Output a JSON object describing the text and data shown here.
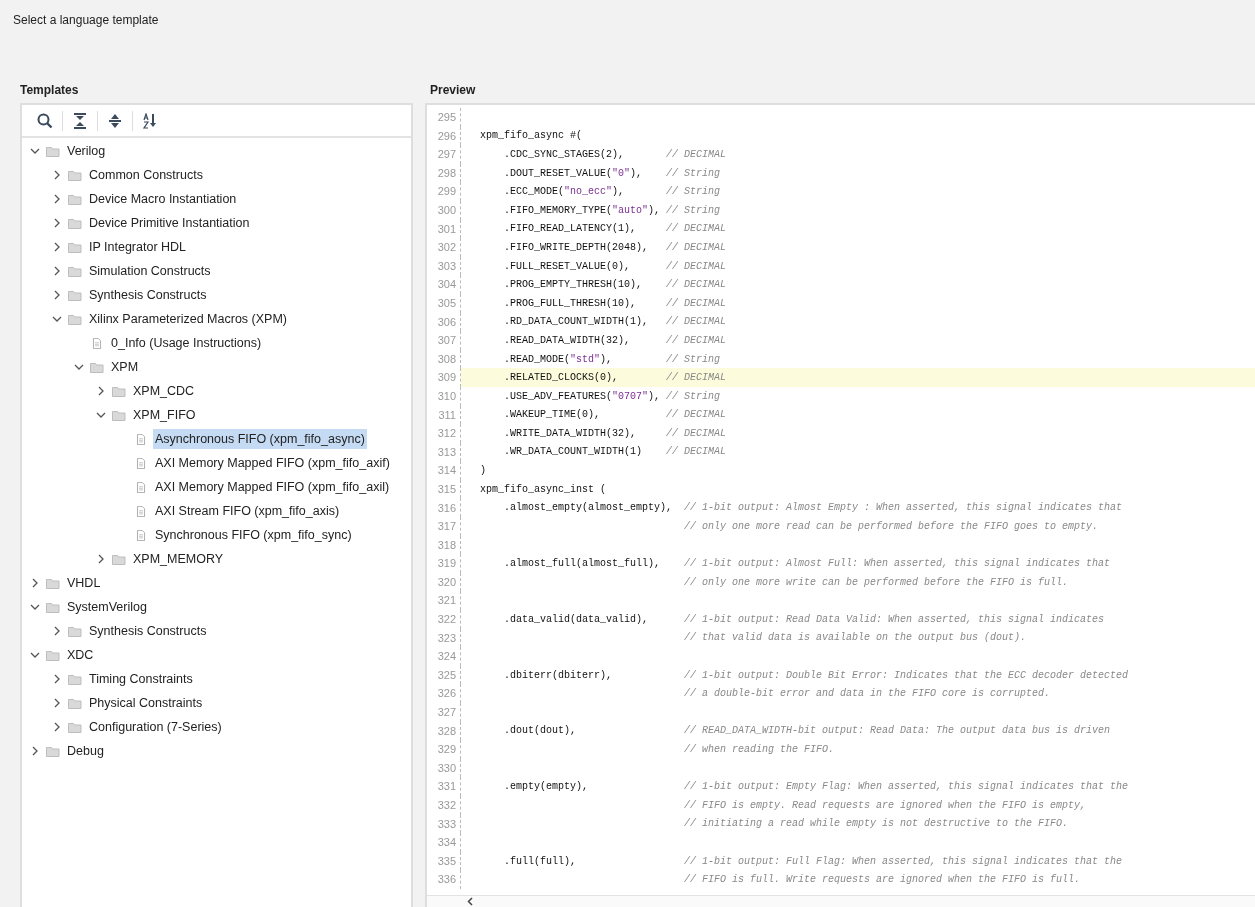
{
  "heading": "Select a language template",
  "templates": {
    "title": "Templates",
    "tree": [
      {
        "label": "Verilog",
        "kind": "folder",
        "expanded": true,
        "selected": false,
        "children": [
          {
            "label": "Common Constructs",
            "kind": "folder",
            "expanded": false,
            "selected": false
          },
          {
            "label": "Device Macro Instantiation",
            "kind": "folder",
            "expanded": false,
            "selected": false
          },
          {
            "label": "Device Primitive Instantiation",
            "kind": "folder",
            "expanded": false,
            "selected": false
          },
          {
            "label": "IP Integrator HDL",
            "kind": "folder",
            "expanded": false,
            "selected": false
          },
          {
            "label": "Simulation Constructs",
            "kind": "folder",
            "expanded": false,
            "selected": false
          },
          {
            "label": "Synthesis Constructs",
            "kind": "folder",
            "expanded": false,
            "selected": false
          },
          {
            "label": "Xilinx Parameterized Macros (XPM)",
            "kind": "folder",
            "expanded": true,
            "selected": false,
            "children": [
              {
                "label": "0_Info (Usage Instructions)",
                "kind": "file",
                "selected": false
              },
              {
                "label": "XPM",
                "kind": "folder",
                "expanded": true,
                "selected": false,
                "children": [
                  {
                    "label": "XPM_CDC",
                    "kind": "folder",
                    "expanded": false,
                    "selected": false
                  },
                  {
                    "label": "XPM_FIFO",
                    "kind": "folder",
                    "expanded": true,
                    "selected": false,
                    "children": [
                      {
                        "label": "Asynchronous FIFO (xpm_fifo_async)",
                        "kind": "file",
                        "selected": true
                      },
                      {
                        "label": "AXI Memory Mapped FIFO (xpm_fifo_axif)",
                        "kind": "file",
                        "selected": false
                      },
                      {
                        "label": "AXI Memory Mapped FIFO (xpm_fifo_axil)",
                        "kind": "file",
                        "selected": false
                      },
                      {
                        "label": "AXI Stream FIFO (xpm_fifo_axis)",
                        "kind": "file",
                        "selected": false
                      },
                      {
                        "label": "Synchronous FIFO (xpm_fifo_sync)",
                        "kind": "file",
                        "selected": false
                      }
                    ]
                  },
                  {
                    "label": "XPM_MEMORY",
                    "kind": "folder",
                    "expanded": false,
                    "selected": false
                  }
                ]
              }
            ]
          }
        ]
      },
      {
        "label": "VHDL",
        "kind": "folder",
        "expanded": false,
        "selected": false
      },
      {
        "label": "SystemVerilog",
        "kind": "folder",
        "expanded": true,
        "selected": false,
        "children": [
          {
            "label": "Synthesis Constructs",
            "kind": "folder",
            "expanded": false,
            "selected": false
          }
        ]
      },
      {
        "label": "XDC",
        "kind": "folder",
        "expanded": true,
        "selected": false,
        "children": [
          {
            "label": "Timing Constraints",
            "kind": "folder",
            "expanded": false,
            "selected": false
          },
          {
            "label": "Physical Constraints",
            "kind": "folder",
            "expanded": false,
            "selected": false
          },
          {
            "label": "Configuration (7-Series)",
            "kind": "folder",
            "expanded": false,
            "selected": false
          }
        ]
      },
      {
        "label": "Debug",
        "kind": "folder",
        "expanded": false,
        "selected": false
      }
    ]
  },
  "preview": {
    "title": "Preview",
    "lines": [
      {
        "num": "295",
        "kind": "plain"
      },
      {
        "num": "296",
        "kind": "plain",
        "code": [
          {
            "t": "xpm_fifo_async #(",
            "kind": "plain"
          }
        ]
      },
      {
        "num": "297",
        "kind": "param",
        "code": [
          {
            "t": "    .CDC_SYNC_STAGES(2),",
            "kind": "plain"
          }
        ],
        "comment": "// DECIMAL"
      },
      {
        "num": "298",
        "kind": "param",
        "code": [
          {
            "t": "    .DOUT_RESET_VALUE(",
            "kind": "plain"
          },
          {
            "t": "\"0\"",
            "kind": "string"
          },
          {
            "t": "),",
            "kind": "plain"
          }
        ],
        "comment": "// String"
      },
      {
        "num": "299",
        "kind": "param",
        "code": [
          {
            "t": "    .ECC_MODE(",
            "kind": "plain"
          },
          {
            "t": "\"no_ecc\"",
            "kind": "string"
          },
          {
            "t": "),",
            "kind": "plain"
          }
        ],
        "comment": "// String"
      },
      {
        "num": "300",
        "kind": "param",
        "code": [
          {
            "t": "    .FIFO_MEMORY_TYPE(",
            "kind": "plain"
          },
          {
            "t": "\"auto\"",
            "kind": "string"
          },
          {
            "t": "),",
            "kind": "plain"
          }
        ],
        "comment": "// String"
      },
      {
        "num": "301",
        "kind": "param",
        "code": [
          {
            "t": "    .FIFO_READ_LATENCY(1),",
            "kind": "plain"
          }
        ],
        "comment": "// DECIMAL"
      },
      {
        "num": "302",
        "kind": "param",
        "code": [
          {
            "t": "    .FIFO_WRITE_DEPTH(2048),",
            "kind": "plain"
          }
        ],
        "comment": "// DECIMAL"
      },
      {
        "num": "303",
        "kind": "param",
        "code": [
          {
            "t": "    .FULL_RESET_VALUE(0),",
            "kind": "plain"
          }
        ],
        "comment": "// DECIMAL"
      },
      {
        "num": "304",
        "kind": "param",
        "code": [
          {
            "t": "    .PROG_EMPTY_THRESH(10),",
            "kind": "plain"
          }
        ],
        "comment": "// DECIMAL"
      },
      {
        "num": "305",
        "kind": "param",
        "code": [
          {
            "t": "    .PROG_FULL_THRESH(10),",
            "kind": "plain"
          }
        ],
        "comment": "// DECIMAL"
      },
      {
        "num": "306",
        "kind": "param",
        "code": [
          {
            "t": "    .RD_DATA_COUNT_WIDTH(1),",
            "kind": "plain"
          }
        ],
        "comment": "// DECIMAL"
      },
      {
        "num": "307",
        "kind": "param",
        "code": [
          {
            "t": "    .READ_DATA_WIDTH(32),",
            "kind": "plain"
          }
        ],
        "comment": "// DECIMAL"
      },
      {
        "num": "308",
        "kind": "param",
        "code": [
          {
            "t": "    .READ_MODE(",
            "kind": "plain"
          },
          {
            "t": "\"std\"",
            "kind": "string"
          },
          {
            "t": "),",
            "kind": "plain"
          }
        ],
        "comment": "// String"
      },
      {
        "num": "309",
        "kind": "param",
        "highlighted": true,
        "code": [
          {
            "t": "    .RELATED_CLOCKS(0),",
            "kind": "plain"
          }
        ],
        "comment": "// DECIMAL"
      },
      {
        "num": "310",
        "kind": "param",
        "code": [
          {
            "t": "    .USE_ADV_FEATURES(",
            "kind": "plain"
          },
          {
            "t": "\"0707\"",
            "kind": "string"
          },
          {
            "t": "),",
            "kind": "plain"
          }
        ],
        "comment": "// String"
      },
      {
        "num": "311",
        "kind": "param",
        "code": [
          {
            "t": "    .WAKEUP_TIME(0),",
            "kind": "plain"
          }
        ],
        "comment": "// DECIMAL"
      },
      {
        "num": "312",
        "kind": "param",
        "code": [
          {
            "t": "    .WRITE_DATA_WIDTH(32),",
            "kind": "plain"
          }
        ],
        "comment": "// DECIMAL"
      },
      {
        "num": "313",
        "kind": "param",
        "code": [
          {
            "t": "    .WR_DATA_COUNT_WIDTH(1)",
            "kind": "plain"
          }
        ],
        "comment": "// DECIMAL"
      },
      {
        "num": "314",
        "kind": "plain",
        "code": [
          {
            "t": ")",
            "kind": "plain"
          }
        ]
      },
      {
        "num": "315",
        "kind": "plain",
        "code": [
          {
            "t": "xpm_fifo_async_inst (",
            "kind": "plain"
          }
        ]
      },
      {
        "num": "316",
        "kind": "port",
        "code": [
          {
            "t": "    .almost_empty(almost_empty),",
            "kind": "plain"
          }
        ],
        "comment": "// 1-bit output: Almost Empty : When asserted, this signal indicates that"
      },
      {
        "num": "317",
        "kind": "port",
        "comment": "// only one more read can be performed before the FIFO goes to empty."
      },
      {
        "num": "318",
        "kind": "plain"
      },
      {
        "num": "319",
        "kind": "port",
        "code": [
          {
            "t": "    .almost_full(almost_full),",
            "kind": "plain"
          }
        ],
        "comment": "// 1-bit output: Almost Full: When asserted, this signal indicates that"
      },
      {
        "num": "320",
        "kind": "port",
        "comment": "// only one more write can be performed before the FIFO is full."
      },
      {
        "num": "321",
        "kind": "plain"
      },
      {
        "num": "322",
        "kind": "port",
        "code": [
          {
            "t": "    .data_valid(data_valid),",
            "kind": "plain"
          }
        ],
        "comment": "// 1-bit output: Read Data Valid: When asserted, this signal indicates"
      },
      {
        "num": "323",
        "kind": "port",
        "comment": "// that valid data is available on the output bus (dout)."
      },
      {
        "num": "324",
        "kind": "plain"
      },
      {
        "num": "325",
        "kind": "port",
        "code": [
          {
            "t": "    .dbiterr(dbiterr),",
            "kind": "plain"
          }
        ],
        "comment": "// 1-bit output: Double Bit Error: Indicates that the ECC decoder detected"
      },
      {
        "num": "326",
        "kind": "port",
        "comment": "// a double-bit error and data in the FIFO core is corrupted."
      },
      {
        "num": "327",
        "kind": "plain"
      },
      {
        "num": "328",
        "kind": "port",
        "code": [
          {
            "t": "    .dout(dout),",
            "kind": "plain"
          }
        ],
        "comment": "// READ_DATA_WIDTH-bit output: Read Data: The output data bus is driven"
      },
      {
        "num": "329",
        "kind": "port",
        "comment": "// when reading the FIFO."
      },
      {
        "num": "330",
        "kind": "plain"
      },
      {
        "num": "331",
        "kind": "port",
        "code": [
          {
            "t": "    .empty(empty),",
            "kind": "plain"
          }
        ],
        "comment": "// 1-bit output: Empty Flag: When asserted, this signal indicates that the"
      },
      {
        "num": "332",
        "kind": "port",
        "comment": "// FIFO is empty. Read requests are ignored when the FIFO is empty,"
      },
      {
        "num": "333",
        "kind": "port",
        "comment": "// initiating a read while empty is not destructive to the FIFO."
      },
      {
        "num": "334",
        "kind": "plain"
      },
      {
        "num": "335",
        "kind": "port",
        "code": [
          {
            "t": "    .full(full),",
            "kind": "plain"
          }
        ],
        "comment": "// 1-bit output: Full Flag: When asserted, this signal indicates that the"
      },
      {
        "num": "336",
        "kind": "port",
        "comment": "// FIFO is full. Write requests are ignored when the FIFO is full."
      }
    ]
  }
}
